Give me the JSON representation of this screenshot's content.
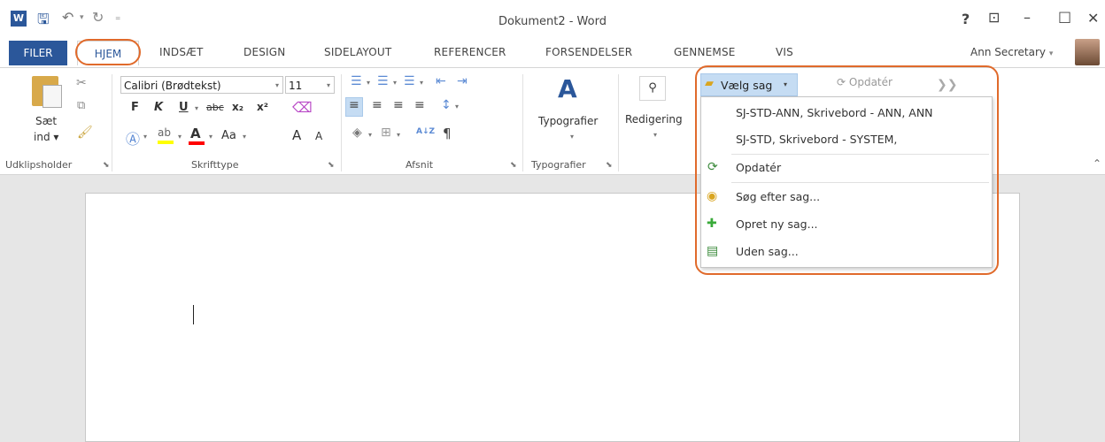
{
  "window": {
    "title": "Dokument2 - Word",
    "help": "?",
    "restore_ribbon": "⊡",
    "minimize": "–",
    "maximize": "□",
    "close": "✕"
  },
  "qat": {
    "word_logo": "W",
    "save": "🖫",
    "undo": "↶",
    "undo_arrow": "▾",
    "redo": "↻",
    "customize": "₌"
  },
  "tabs": [
    "FILER",
    "HJEM",
    "INDSÆT",
    "DESIGN",
    "SIDELAYOUT",
    "REFERENCER",
    "FORSENDELSER",
    "GENNEMSE",
    "VIS"
  ],
  "user": {
    "name": "Ann Secretary",
    "arrow": "▾"
  },
  "ribbon": {
    "clipboard": {
      "paste_label_1": "Sæt",
      "paste_label_2": "ind ▾",
      "group_label": "Udklipsholder"
    },
    "font": {
      "font_name": "Calibri (Brødtekst)",
      "font_size": "11",
      "bold": "F",
      "italic": "K",
      "underline": "U",
      "strike": "abc",
      "subscript": "x₂",
      "superscript": "x²",
      "grow": "A",
      "shrink": "A",
      "case": "Aa",
      "group_label": "Skrifttype"
    },
    "paragraph": {
      "sort": "A↓Z",
      "pilcrow": "¶",
      "group_label": "Afsnit"
    },
    "styles": {
      "label": "Typografier",
      "arrow": "▾",
      "group_label": "Typografier"
    },
    "editing": {
      "label": "Redigering",
      "arrow": "▾"
    },
    "addin": {
      "select_case": "Vælg sag",
      "arrow": "▾",
      "update": "Opdatér"
    },
    "collapse": "⌃"
  },
  "dropdown": {
    "items": [
      {
        "label": "SJ-STD-ANN, Skrivebord - ANN, ANN",
        "icon": ""
      },
      {
        "label": "SJ-STD, Skrivebord - SYSTEM,",
        "icon": ""
      },
      {
        "label": "Opdatér",
        "icon": "refresh-icon"
      },
      {
        "label": "Søg efter sag...",
        "icon": "search-case-icon"
      },
      {
        "label": "Opret ny sag...",
        "icon": "new-case-icon"
      },
      {
        "label": "Uden sag...",
        "icon": "no-case-icon"
      }
    ]
  }
}
